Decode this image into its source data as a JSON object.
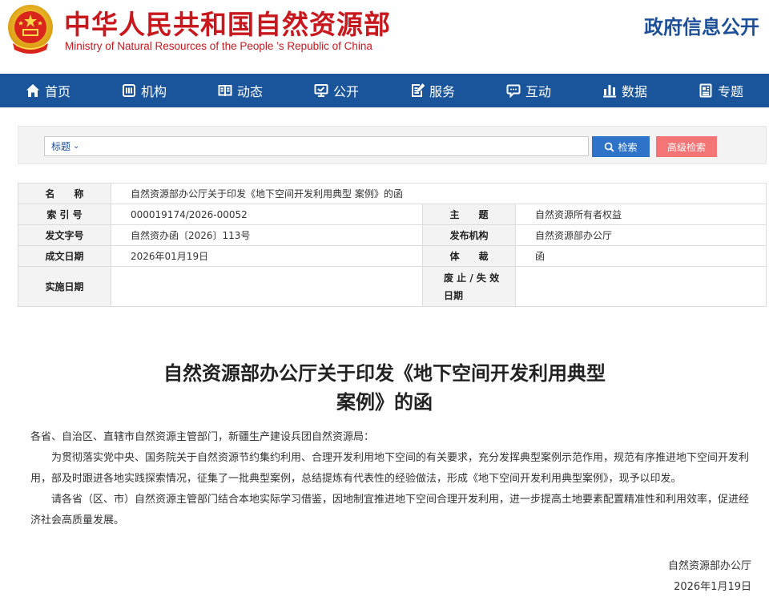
{
  "header": {
    "title_cn": "中华人民共和国自然资源部",
    "title_en": "Ministry of Natural Resources of the People ’s Republic of China",
    "right_title": "政府信息公开",
    "emblem_icon": "national-emblem-icon",
    "colors": {
      "title": "#c8171d",
      "right_title": "#1d4f99"
    }
  },
  "nav": {
    "color": "#1a559b",
    "items": [
      {
        "label": "首页",
        "icon": "home-icon"
      },
      {
        "label": "机构",
        "icon": "org-icon"
      },
      {
        "label": "动态",
        "icon": "book-icon"
      },
      {
        "label": "公开",
        "icon": "monitor-icon"
      },
      {
        "label": "服务",
        "icon": "edit-doc-icon"
      },
      {
        "label": "互动",
        "icon": "chat-icon"
      },
      {
        "label": "数据",
        "icon": "bar-chart-icon"
      },
      {
        "label": "专题",
        "icon": "document-icon"
      }
    ]
  },
  "search": {
    "field_label": "标题",
    "query": "",
    "search_label": "检索",
    "advanced_label": "高级检索",
    "colors": {
      "search_button": "#2f73c8",
      "advanced_button": "#f37575"
    }
  },
  "meta": {
    "name_label": "名　　称",
    "name_value": "自然资源部办公厅关于印发《地下空间开发利用典型 案例》的函",
    "index_label": "索 引 号",
    "index_value": "000019174/2026-00052",
    "topic_label": "主　　题",
    "topic_value": "自然资源所有者权益",
    "docno_label": "发文字号",
    "docno_value": "自然资办函〔2026〕113号",
    "issuer_label": "发布机构",
    "issuer_value": "自然资源部办公厅",
    "date_label": "成文日期",
    "date_value": "2026年01月19日",
    "genre_label": "体　　裁",
    "genre_value": "函",
    "effective_label": "实施日期",
    "effective_value": "",
    "repeal_label_1": "废 止 / 失 效",
    "repeal_label_2": "日期",
    "repeal_value": ""
  },
  "article": {
    "title_line1": "自然资源部办公厅关于印发《地下空间开发利用典型",
    "title_line2": "案例》的函",
    "salutation": "各省、自治区、直辖市自然资源主管部门，新疆生产建设兵团自然资源局：",
    "para1": "为贯彻落实党中央、国务院关于自然资源节约集约利用、合理开发利用地下空间的有关要求，充分发挥典型案例示范作用，规范有序推进地下空间开发利用，部及时跟进各地实践探索情况，征集了一批典型案例，总结提炼有代表性的经验做法，形成《地下空间开发利用典型案例》，现予以印发。",
    "para2": "请各省（区、市）自然资源主管部门结合本地实际学习借鉴，因地制宜推进地下空间合理开发利用，进一步提高土地要素配置精准性和利用效率，促进经济社会高质量发展。",
    "signer": "自然资源部办公厅",
    "sign_date": "2026年1月19日"
  }
}
